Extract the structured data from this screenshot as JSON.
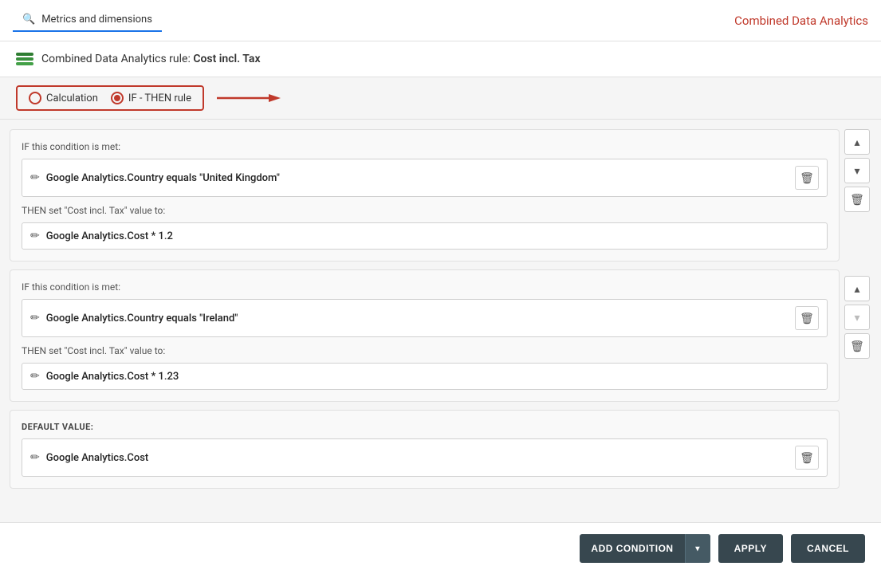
{
  "header": {
    "tab_label": "Metrics and dimensions",
    "app_title": "Combined Data Analytics"
  },
  "rule": {
    "label": "Combined Data Analytics rule:",
    "name": "Cost incl. Tax"
  },
  "radio_group": {
    "option1_label": "Calculation",
    "option2_label": "IF - THEN rule",
    "selected": "option2"
  },
  "conditions": [
    {
      "id": "cond1",
      "if_label": "IF this condition is met:",
      "if_value": "Google Analytics.Country equals \"United Kingdom\"",
      "then_label": "THEN set \"Cost incl. Tax\" value to:",
      "then_value": "Google Analytics.Cost * 1.2"
    },
    {
      "id": "cond2",
      "if_label": "IF this condition is met:",
      "if_value": "Google Analytics.Country equals \"Ireland\"",
      "then_label": "THEN set \"Cost incl. Tax\" value to:",
      "then_value": "Google Analytics.Cost * 1.23"
    }
  ],
  "default_block": {
    "label": "DEFAULT VALUE:",
    "value": "Google Analytics.Cost"
  },
  "side_controls": [
    {
      "group": 1,
      "up": "▲",
      "down": "▼",
      "delete": "🗑"
    },
    {
      "group": 2,
      "up": "▲",
      "down": "▼",
      "delete": "🗑"
    }
  ],
  "footer": {
    "add_condition_label": "ADD CONDITION",
    "apply_label": "APPLY",
    "cancel_label": "CANCEL"
  },
  "icons": {
    "edit": "✏",
    "delete": "🗑",
    "chevron_down": "▾",
    "chevron_up": "▴",
    "search": "🔍"
  }
}
